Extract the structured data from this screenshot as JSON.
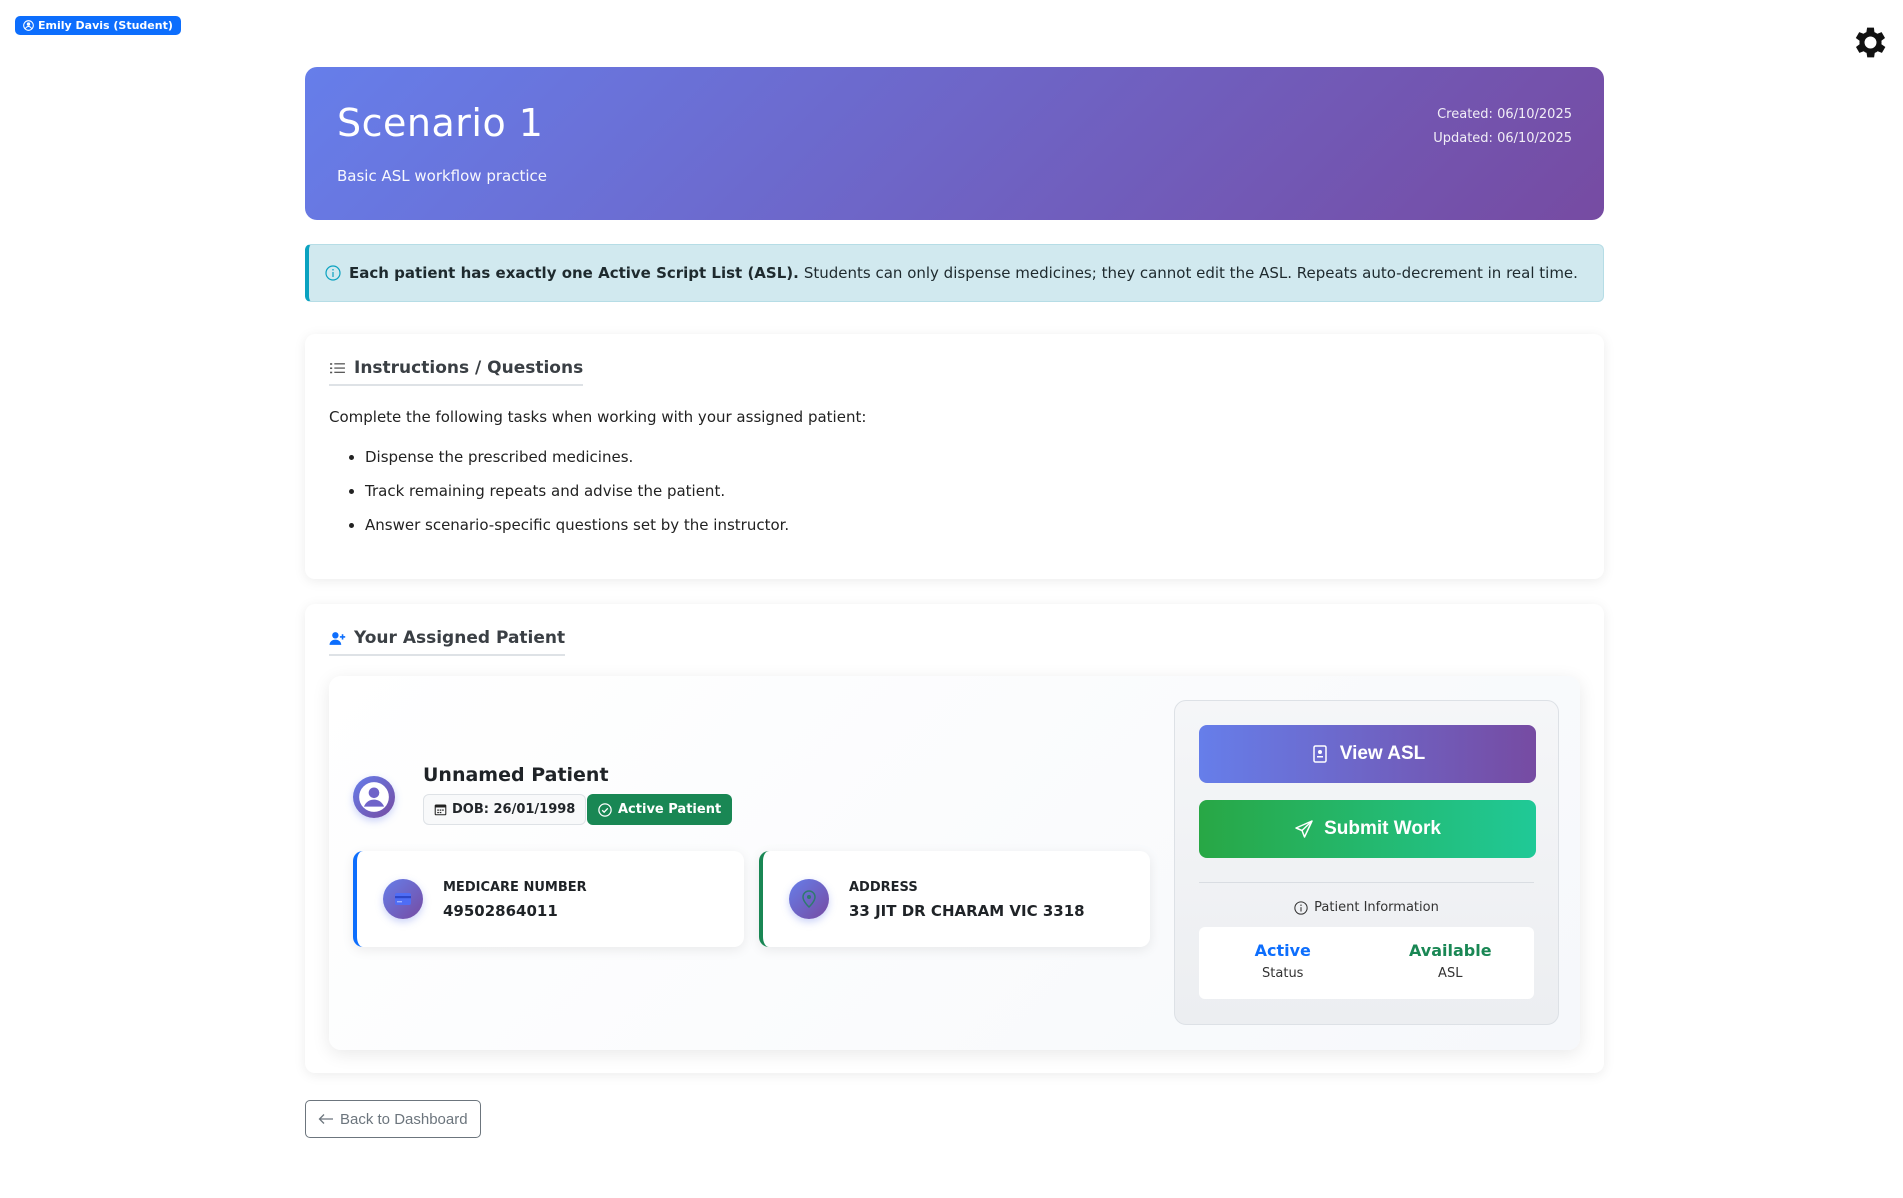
{
  "user": {
    "badge_label": "Emily Davis (Student)"
  },
  "header": {
    "title": "Scenario 1",
    "subtitle": "Basic ASL workflow practice",
    "created": "Created: 06/10/2025",
    "updated": "Updated: 06/10/2025"
  },
  "alert": {
    "bold": "Each patient has exactly one Active Script List (ASL).",
    "text": "Students can only dispense medicines; they cannot edit the ASL. Repeats auto-decrement in real time."
  },
  "instructions": {
    "title": "Instructions / Questions",
    "intro": "Complete the following tasks when working with your assigned patient:",
    "items": [
      "Dispense the prescribed medicines.",
      "Track remaining repeats and advise the patient.",
      "Answer scenario-specific questions set by the instructor."
    ]
  },
  "patient": {
    "section_title": "Your Assigned Patient",
    "name": "Unnamed Patient",
    "dob": "DOB: 26/01/1998",
    "status_badge": "Active Patient",
    "medicare_label": "MEDICARE NUMBER",
    "medicare_value": "49502864011",
    "address_label": "ADDRESS",
    "address_value": "33 JIT DR CHARAM VIC 3318"
  },
  "actions": {
    "view_asl": "View ASL",
    "submit_work": "Submit Work",
    "info_title": "Patient Information",
    "stats": [
      {
        "value": "Active",
        "label": "Status"
      },
      {
        "value": "Available",
        "label": "ASL"
      }
    ]
  },
  "nav": {
    "back_label": "Back to Dashboard"
  },
  "colors": {
    "brand_gradient_start": "#667eea",
    "brand_gradient_end": "#764ba2",
    "primary": "#0d6efd",
    "success": "#198754",
    "info": "#0aa2c0"
  },
  "icons": [
    "user-circle-icon",
    "gear-icon",
    "info-icon",
    "list-icon",
    "user-plus-icon",
    "user-avatar-icon",
    "calendar-icon",
    "check-circle-icon",
    "credit-card-icon",
    "location-pin-icon",
    "id-card-icon",
    "send-icon",
    "arrow-left-icon"
  ]
}
